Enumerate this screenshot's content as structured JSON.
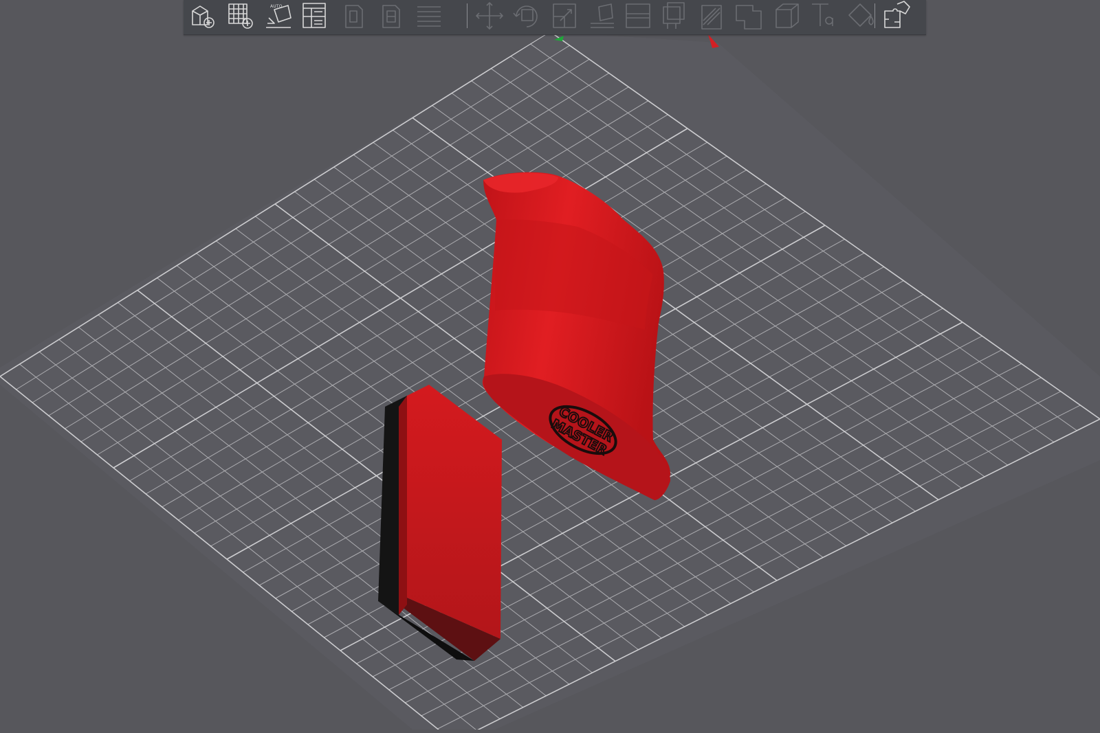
{
  "app": {
    "accent_color": "#d42024",
    "background_color": "#57575c",
    "toolbar_color": "#45474c"
  },
  "toolbar": {
    "buttons": [
      {
        "name": "add-object",
        "icon": "cube-plus-icon",
        "enabled": true
      },
      {
        "name": "add-plate",
        "icon": "grid-plus-icon",
        "enabled": true
      },
      {
        "name": "auto-orient",
        "icon": "auto-orient-icon",
        "label": "AUTO",
        "enabled": true
      },
      {
        "name": "arrange",
        "icon": "arrange-layout-icon",
        "enabled": true
      },
      {
        "name": "copy",
        "icon": "copy-icon",
        "enabled": false
      },
      {
        "name": "paste",
        "icon": "paste-icon",
        "enabled": false
      },
      {
        "name": "layers",
        "icon": "layers-icon",
        "enabled": false
      },
      {
        "name": "move",
        "icon": "move-arrows-icon",
        "enabled": false
      },
      {
        "name": "rotate",
        "icon": "rotate-icon",
        "enabled": false
      },
      {
        "name": "scale",
        "icon": "scale-icon",
        "enabled": false
      },
      {
        "name": "lay-on-face",
        "icon": "lay-flat-icon",
        "enabled": false
      },
      {
        "name": "cut",
        "icon": "cut-icon",
        "enabled": false
      },
      {
        "name": "support-paint",
        "icon": "support-paint-icon",
        "enabled": false
      },
      {
        "name": "seam-paint",
        "icon": "seam-paint-icon",
        "enabled": false
      },
      {
        "name": "boolean",
        "icon": "boolean-icon",
        "enabled": false
      },
      {
        "name": "measure",
        "icon": "measure-box-icon",
        "enabled": false
      },
      {
        "name": "text",
        "icon": "text-emboss-icon",
        "enabled": false
      },
      {
        "name": "color-paint",
        "icon": "paint-bucket-icon",
        "enabled": false
      },
      {
        "name": "assembly",
        "icon": "puzzle-assembly-icon",
        "enabled": true
      }
    ]
  },
  "scene": {
    "plate_grid_color": "#c9c9cc",
    "axis_x_color": "#d42024",
    "axis_y_color": "#1fa83a",
    "objects": [
      {
        "name": "duct-part",
        "color": "#d7191c"
      },
      {
        "name": "block-part",
        "color": "#d7191c",
        "secondary_color": "#111111"
      }
    ],
    "logo_text_line1": "COOLER",
    "logo_text_line2": "MASTER"
  }
}
